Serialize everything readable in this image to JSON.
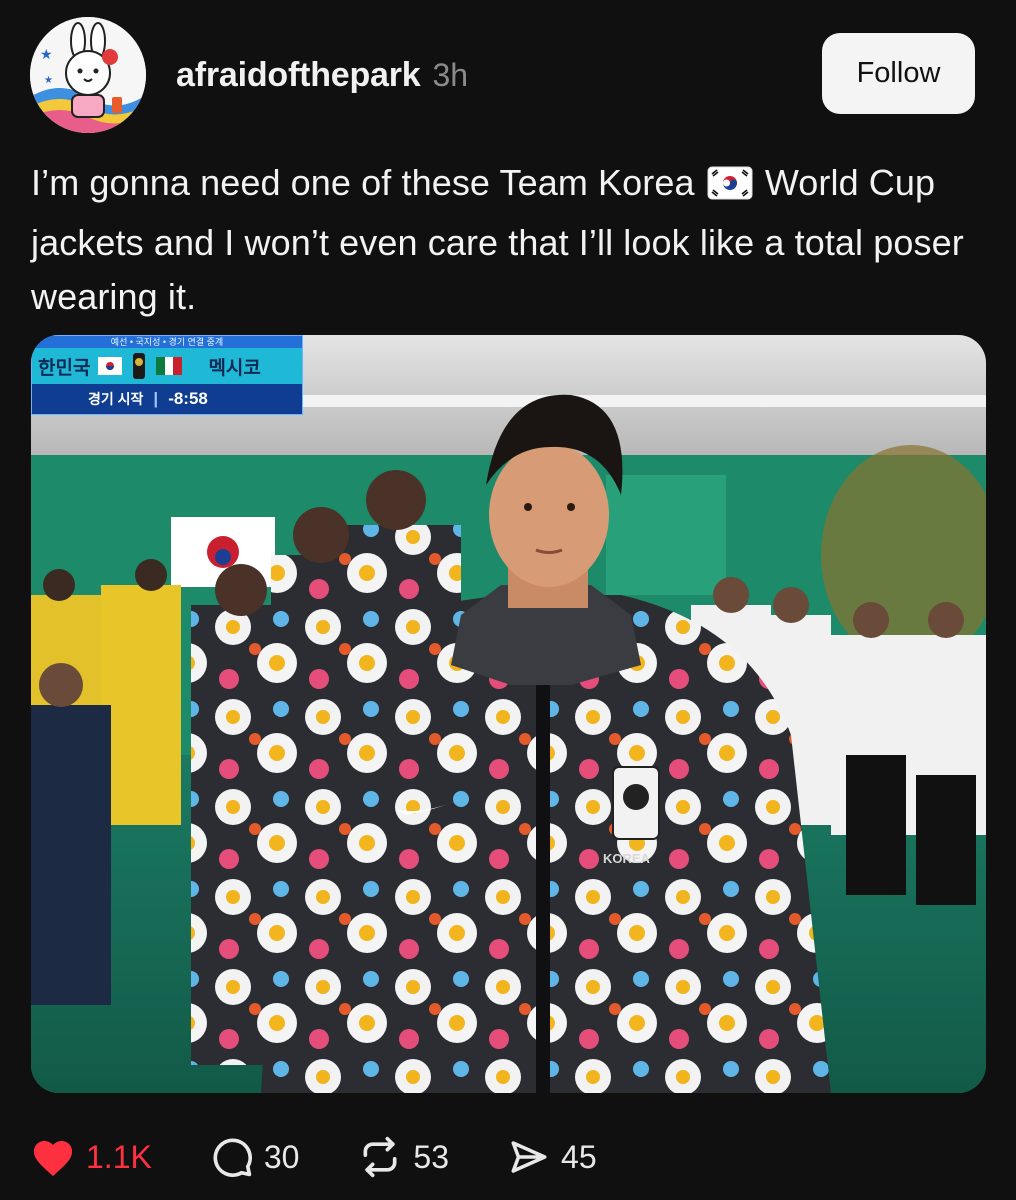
{
  "theme": {
    "background": "#101010",
    "like_color": "#ff3040"
  },
  "post": {
    "author": "afraidofthepark",
    "time": "3h",
    "follow_label": "Follow",
    "text_before_flag": "I’m gonna need one of these Team Korea",
    "flag_icon": "south-korea-flag-emoji",
    "text_after_flag": "World Cup jackets and I won’t even care that I’ll look like a total poser wearing it.",
    "media": {
      "scoreboard": {
        "header": "예선 • 국지성 • 경기 연결 중계",
        "team_home": "한민국",
        "team_away": "멕시코",
        "status_label": "경기 시작",
        "clock": "-8:58"
      },
      "jacket_badge": "KOREA"
    }
  },
  "actions": {
    "likes": {
      "icon": "heart-icon",
      "count": "1.1K"
    },
    "replies": {
      "icon": "comment-icon",
      "count": "30"
    },
    "reposts": {
      "icon": "repost-icon",
      "count": "53"
    },
    "shares": {
      "icon": "send-icon",
      "count": "45"
    }
  }
}
